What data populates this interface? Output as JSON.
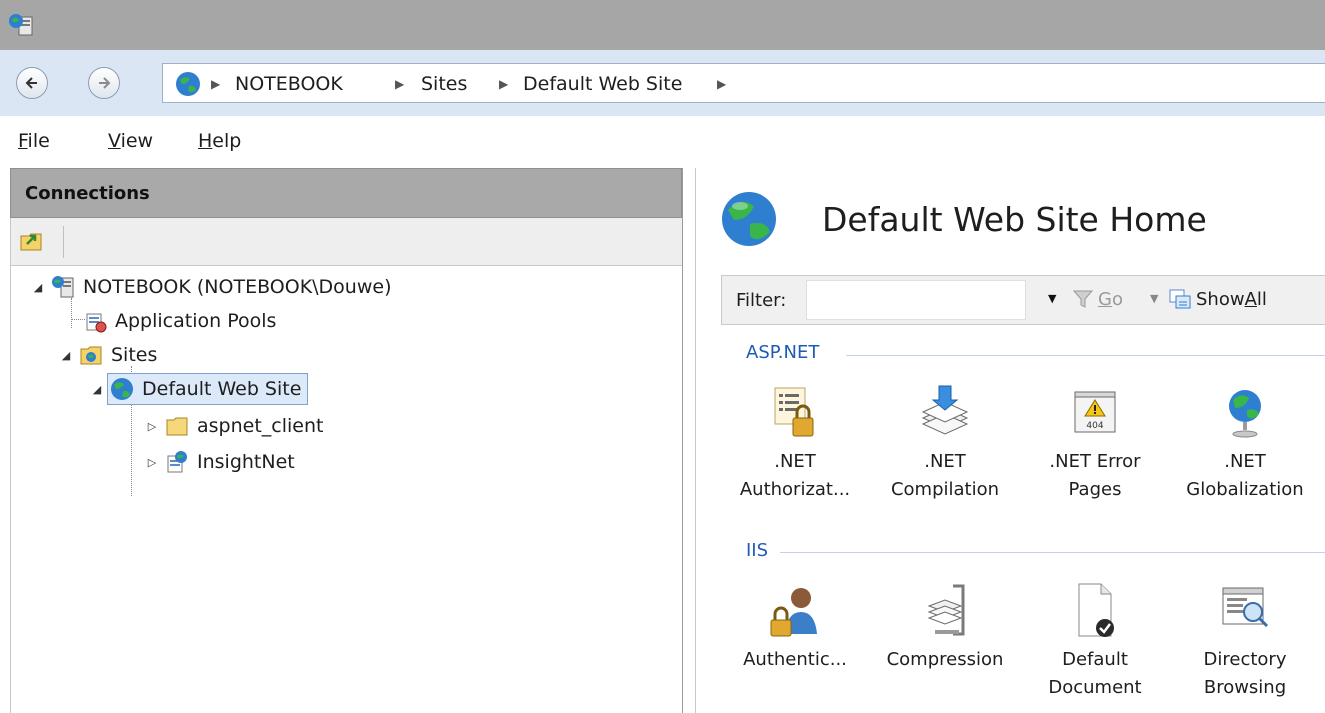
{
  "breadcrumb": {
    "items": [
      "NOTEBOOK",
      "Sites",
      "Default Web Site"
    ]
  },
  "menu": {
    "items": [
      {
        "label": "File",
        "accel": "F",
        "rest": "ile"
      },
      {
        "label": "View",
        "accel": "V",
        "rest": "iew"
      },
      {
        "label": "Help",
        "accel": "H",
        "rest": "elp"
      }
    ]
  },
  "connections": {
    "title": "Connections",
    "tree": {
      "server": "NOTEBOOK (NOTEBOOK\\Douwe)",
      "app_pools": "Application Pools",
      "sites": "Sites",
      "default_site": "Default Web Site",
      "aspnet_client": "aspnet_client",
      "insightnet": "InsightNet"
    }
  },
  "main": {
    "title": "Default Web Site Home",
    "filter": {
      "label": "Filter:",
      "value": "",
      "go_label": "Go",
      "go_accel": "G",
      "go_rest": "o",
      "showall_label": "Show All",
      "showall_pre": "Show ",
      "showall_accel": "A",
      "showall_rest": "ll"
    },
    "groups": [
      {
        "name": "ASP.NET",
        "features": [
          {
            "line1": ".NET",
            "line2": "Authorizat...",
            "icon": "authorization-icon"
          },
          {
            "line1": ".NET",
            "line2": "Compilation",
            "icon": "compilation-icon"
          },
          {
            "line1": ".NET Error",
            "line2": "Pages",
            "icon": "error-pages-icon"
          },
          {
            "line1": ".NET",
            "line2": "Globalization",
            "icon": "globalization-icon"
          }
        ]
      },
      {
        "name": "IIS",
        "features": [
          {
            "line1": "Authentic...",
            "line2": "",
            "icon": "authentication-icon"
          },
          {
            "line1": "Compression",
            "line2": "",
            "icon": "compression-icon"
          },
          {
            "line1": "Default",
            "line2": "Document",
            "icon": "default-document-icon"
          },
          {
            "line1": "Directory",
            "line2": "Browsing",
            "icon": "directory-browsing-icon"
          }
        ]
      }
    ]
  },
  "icons": {
    "error_code": "404"
  },
  "colors": {
    "group_header": "#1e5bb5",
    "selection_bg": "#dbe9f9",
    "selection_border": "#7da2ce",
    "titlebar": "#a6a6a6",
    "addressbar": "#dbe6f4"
  }
}
